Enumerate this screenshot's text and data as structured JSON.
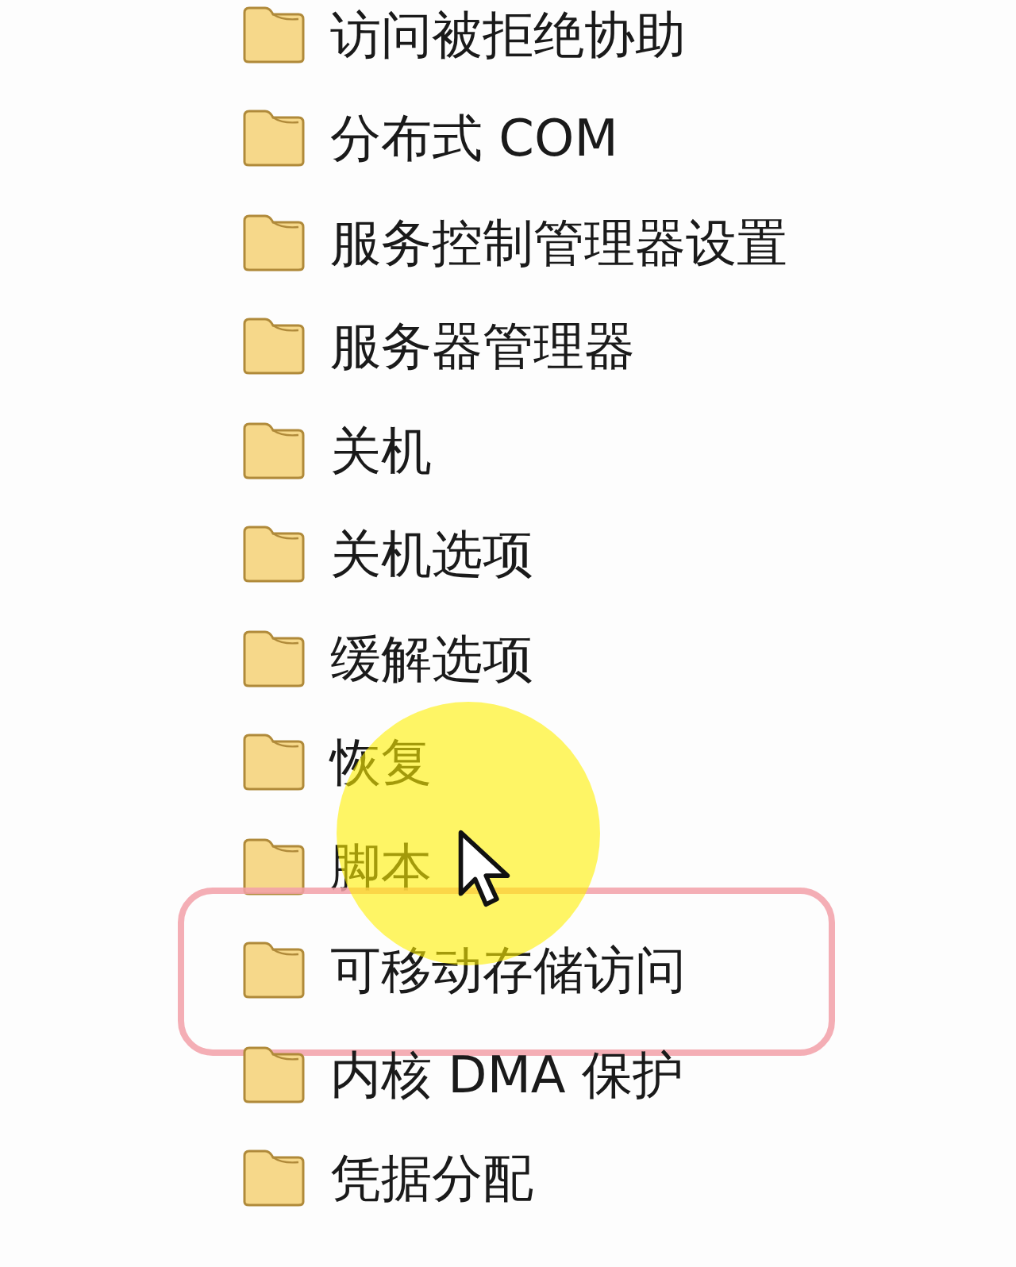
{
  "folders": [
    {
      "label": "访问被拒绝协助",
      "marked": false
    },
    {
      "label": "分布式 COM",
      "marked": false
    },
    {
      "label": "服务控制管理器设置",
      "marked": false
    },
    {
      "label": "服务器管理器",
      "marked": false
    },
    {
      "label": "关机",
      "marked": false
    },
    {
      "label": "关机选项",
      "marked": false
    },
    {
      "label": "缓解选项",
      "marked": false
    },
    {
      "label": "恢复",
      "marked": false
    },
    {
      "label": "脚本",
      "marked": false
    },
    {
      "label": "可移动存储访问",
      "marked": true
    },
    {
      "label": "内核 DMA 保护",
      "marked": false
    },
    {
      "label": "凭据分配",
      "marked": false
    }
  ]
}
